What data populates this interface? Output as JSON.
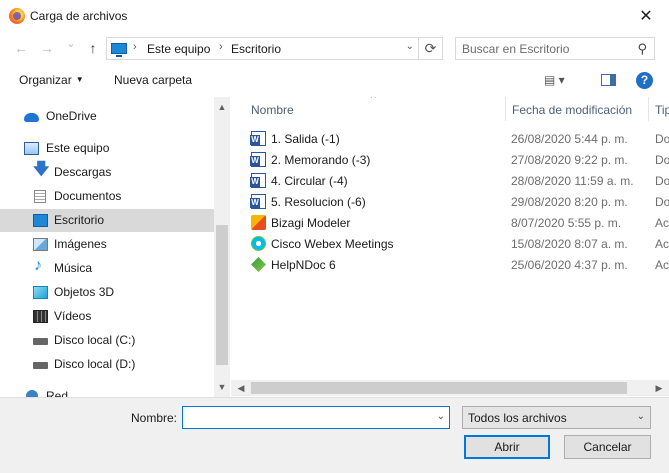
{
  "window": {
    "title": "Carga de archivos",
    "close_glyph": "✕"
  },
  "nav": {
    "back_glyph": "←",
    "forward_glyph": "→",
    "recent_glyph": "⌄",
    "up_glyph": "↑",
    "breadcrumb": [
      "Este equipo",
      "Escritorio"
    ],
    "breadcrumb_sep": "›",
    "dropdown_glyph": "⌄",
    "refresh_glyph": "⟳",
    "search_placeholder": "Buscar en Escritorio",
    "search_glyph": "⚲"
  },
  "toolbar": {
    "organize": "Organizar",
    "new_folder": "Nueva carpeta",
    "caret": "▼",
    "view_glyph": "▤ ▾",
    "help": "?"
  },
  "sidebar": {
    "items": [
      {
        "label": "OneDrive",
        "icon": "onedrive-cloud-icon",
        "selected": false
      },
      {
        "label": "Este equipo",
        "icon": "computer-icon",
        "selected": false
      },
      {
        "label": "Descargas",
        "icon": "downloads-arrow-icon",
        "glyph": "🡇",
        "selected": false
      },
      {
        "label": "Documentos",
        "icon": "documents-icon",
        "selected": false
      },
      {
        "label": "Escritorio",
        "icon": "desktop-icon",
        "selected": true
      },
      {
        "label": "Imágenes",
        "icon": "pictures-icon",
        "selected": false
      },
      {
        "label": "Música",
        "icon": "music-note-icon",
        "glyph": "♪",
        "selected": false
      },
      {
        "label": "Objetos 3D",
        "icon": "3d-objects-icon",
        "selected": false
      },
      {
        "label": "Vídeos",
        "icon": "videos-film-icon",
        "selected": false
      },
      {
        "label": "Disco local (C:)",
        "icon": "local-disk-icon",
        "selected": false
      },
      {
        "label": "Disco local (D:)",
        "icon": "local-disk-icon",
        "selected": false
      },
      {
        "label": "Red",
        "icon": "network-icon",
        "selected": false
      }
    ],
    "scroll_up_glyph": "▲",
    "scroll_down_glyph": "▼"
  },
  "files": {
    "columns": {
      "name": "Nombre",
      "date": "Fecha de modificación",
      "type": "Tipo"
    },
    "sort_glyph": "^",
    "rows": [
      {
        "name": "1. Salida (-1)",
        "date": "26/08/2020 5:44 p. m.",
        "type": "Do",
        "icon": "word-doc-icon"
      },
      {
        "name": "2. Memorando (-3)",
        "date": "27/08/2020 9:22 p. m.",
        "type": "Do",
        "icon": "word-doc-icon"
      },
      {
        "name": "4. Circular (-4)",
        "date": "28/08/2020 11:59 a. m.",
        "type": "Do",
        "icon": "word-doc-icon"
      },
      {
        "name": "5. Resolucion (-6)",
        "date": "29/08/2020 8:20 p. m.",
        "type": "Do",
        "icon": "word-doc-icon"
      },
      {
        "name": "Bizagi Modeler",
        "date": "8/07/2020 5:55 p. m.",
        "type": "Ac",
        "icon": "bizagi-shortcut-icon"
      },
      {
        "name": "Cisco Webex Meetings",
        "date": "15/08/2020 8:07 a. m.",
        "type": "Ac",
        "icon": "webex-shortcut-icon"
      },
      {
        "name": "HelpNDoc 6",
        "date": "25/06/2020 4:37 p. m.",
        "type": "Ac",
        "icon": "helpndoc-shortcut-icon"
      }
    ],
    "hscroll_left_glyph": "◀",
    "hscroll_right_glyph": "▶"
  },
  "footer": {
    "name_label": "Nombre:",
    "name_value": "",
    "dropdown_glyph": "⌄",
    "filter_value": "Todos los archivos",
    "filter_glyph": "⌄",
    "open_label": "Abrir",
    "cancel_label": "Cancelar"
  }
}
